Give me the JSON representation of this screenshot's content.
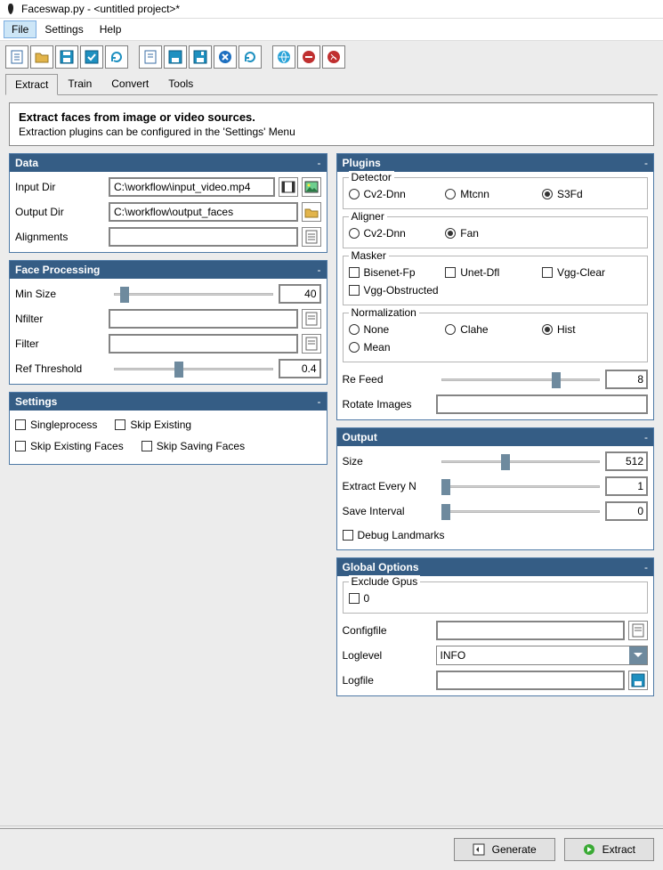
{
  "window": {
    "title": "Faceswap.py - <untitled project>*"
  },
  "menu": {
    "file": "File",
    "settings": "Settings",
    "help": "Help"
  },
  "tabs": {
    "extract": "Extract",
    "train": "Train",
    "convert": "Convert",
    "tools": "Tools"
  },
  "desc": {
    "heading": "Extract faces from image or video sources.",
    "sub": "Extraction plugins can be configured in the 'Settings' Menu"
  },
  "panels": {
    "data": {
      "title": "Data",
      "input_dir_label": "Input Dir",
      "input_dir_value": "C:\\workflow\\input_video.mp4",
      "output_dir_label": "Output Dir",
      "output_dir_value": "C:\\workflow\\output_faces",
      "alignments_label": "Alignments",
      "alignments_value": ""
    },
    "face_processing": {
      "title": "Face Processing",
      "min_size_label": "Min Size",
      "min_size_value": "40",
      "nfilter_label": "Nfilter",
      "nfilter_value": "",
      "filter_label": "Filter",
      "filter_value": "",
      "ref_threshold_label": "Ref Threshold",
      "ref_threshold_value": "0.4"
    },
    "settings": {
      "title": "Settings",
      "singleprocess": "Singleprocess",
      "skip_existing": "Skip Existing",
      "skip_existing_faces": "Skip Existing Faces",
      "skip_saving_faces": "Skip Saving Faces"
    },
    "plugins": {
      "title": "Plugins",
      "detector_legend": "Detector",
      "detector_opts": {
        "cv2": "Cv2-Dnn",
        "mtcnn": "Mtcnn",
        "s3fd": "S3Fd"
      },
      "aligner_legend": "Aligner",
      "aligner_opts": {
        "cv2": "Cv2-Dnn",
        "fan": "Fan"
      },
      "masker_legend": "Masker",
      "masker_opts": {
        "bisenet": "Bisenet-Fp",
        "unet": "Unet-Dfl",
        "vggclear": "Vgg-Clear",
        "vggobs": "Vgg-Obstructed"
      },
      "norm_legend": "Normalization",
      "norm_opts": {
        "none": "None",
        "clahe": "Clahe",
        "hist": "Hist",
        "mean": "Mean"
      },
      "refeed_label": "Re Feed",
      "refeed_value": "8",
      "rotate_label": "Rotate Images",
      "rotate_value": ""
    },
    "output": {
      "title": "Output",
      "size_label": "Size",
      "size_value": "512",
      "extract_every_label": "Extract Every N",
      "extract_every_value": "1",
      "save_interval_label": "Save Interval",
      "save_interval_value": "0",
      "debug_landmarks": "Debug Landmarks"
    },
    "global": {
      "title": "Global Options",
      "exclude_gpus_legend": "Exclude Gpus",
      "exclude_gpus_0": "0",
      "configfile_label": "Configfile",
      "configfile_value": "",
      "loglevel_label": "Loglevel",
      "loglevel_value": "INFO",
      "logfile_label": "Logfile",
      "logfile_value": ""
    }
  },
  "footer": {
    "generate": "Generate",
    "extract": "Extract"
  }
}
